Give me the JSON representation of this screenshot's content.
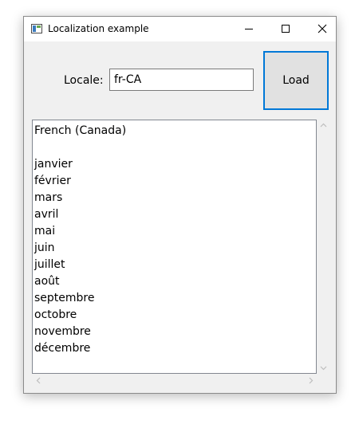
{
  "window": {
    "title": "Localization example",
    "minimize_icon": "minimize-icon",
    "maximize_icon": "maximize-icon",
    "close_icon": "close-icon"
  },
  "form": {
    "locale_label": "Locale:",
    "locale_value": "fr-CA",
    "load_label": "Load"
  },
  "output": {
    "lines": [
      "French (Canada)",
      "",
      "janvier",
      "février",
      "mars",
      "avril",
      "mai",
      "juin",
      "juillet",
      "août",
      "septembre",
      "octobre",
      "novembre",
      "décembre"
    ]
  },
  "colors": {
    "accent": "#0078d7",
    "window_bg": "#f0f0f0"
  }
}
